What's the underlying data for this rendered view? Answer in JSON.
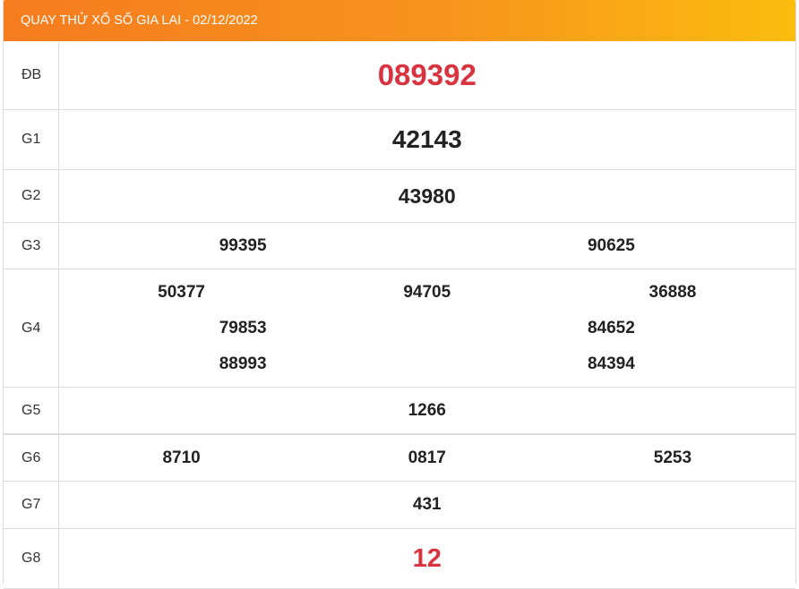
{
  "header": {
    "title": "QUAY THỬ XỔ SỐ GIA LAI - 02/12/2022"
  },
  "prizes": {
    "db": {
      "label": "ĐB",
      "values": [
        "089392"
      ]
    },
    "g1": {
      "label": "G1",
      "values": [
        "42143"
      ]
    },
    "g2": {
      "label": "G2",
      "values": [
        "43980"
      ]
    },
    "g3": {
      "label": "G3",
      "values": [
        "99395",
        "90625"
      ]
    },
    "g4": {
      "label": "G4",
      "values": [
        "50377",
        "94705",
        "36888",
        "79853",
        "84652",
        "88993",
        "84394"
      ]
    },
    "g5": {
      "label": "G5",
      "values": [
        "1266"
      ]
    },
    "g6": {
      "label": "G6",
      "values": [
        "8710",
        "0817",
        "5253"
      ]
    },
    "g7": {
      "label": "G7",
      "values": [
        "431"
      ]
    },
    "g8": {
      "label": "G8",
      "values": [
        "12"
      ]
    }
  },
  "colors": {
    "header_start": "#f57c1f",
    "header_end": "#fbbd0f",
    "highlight": "#d8333f",
    "text": "#222222"
  }
}
